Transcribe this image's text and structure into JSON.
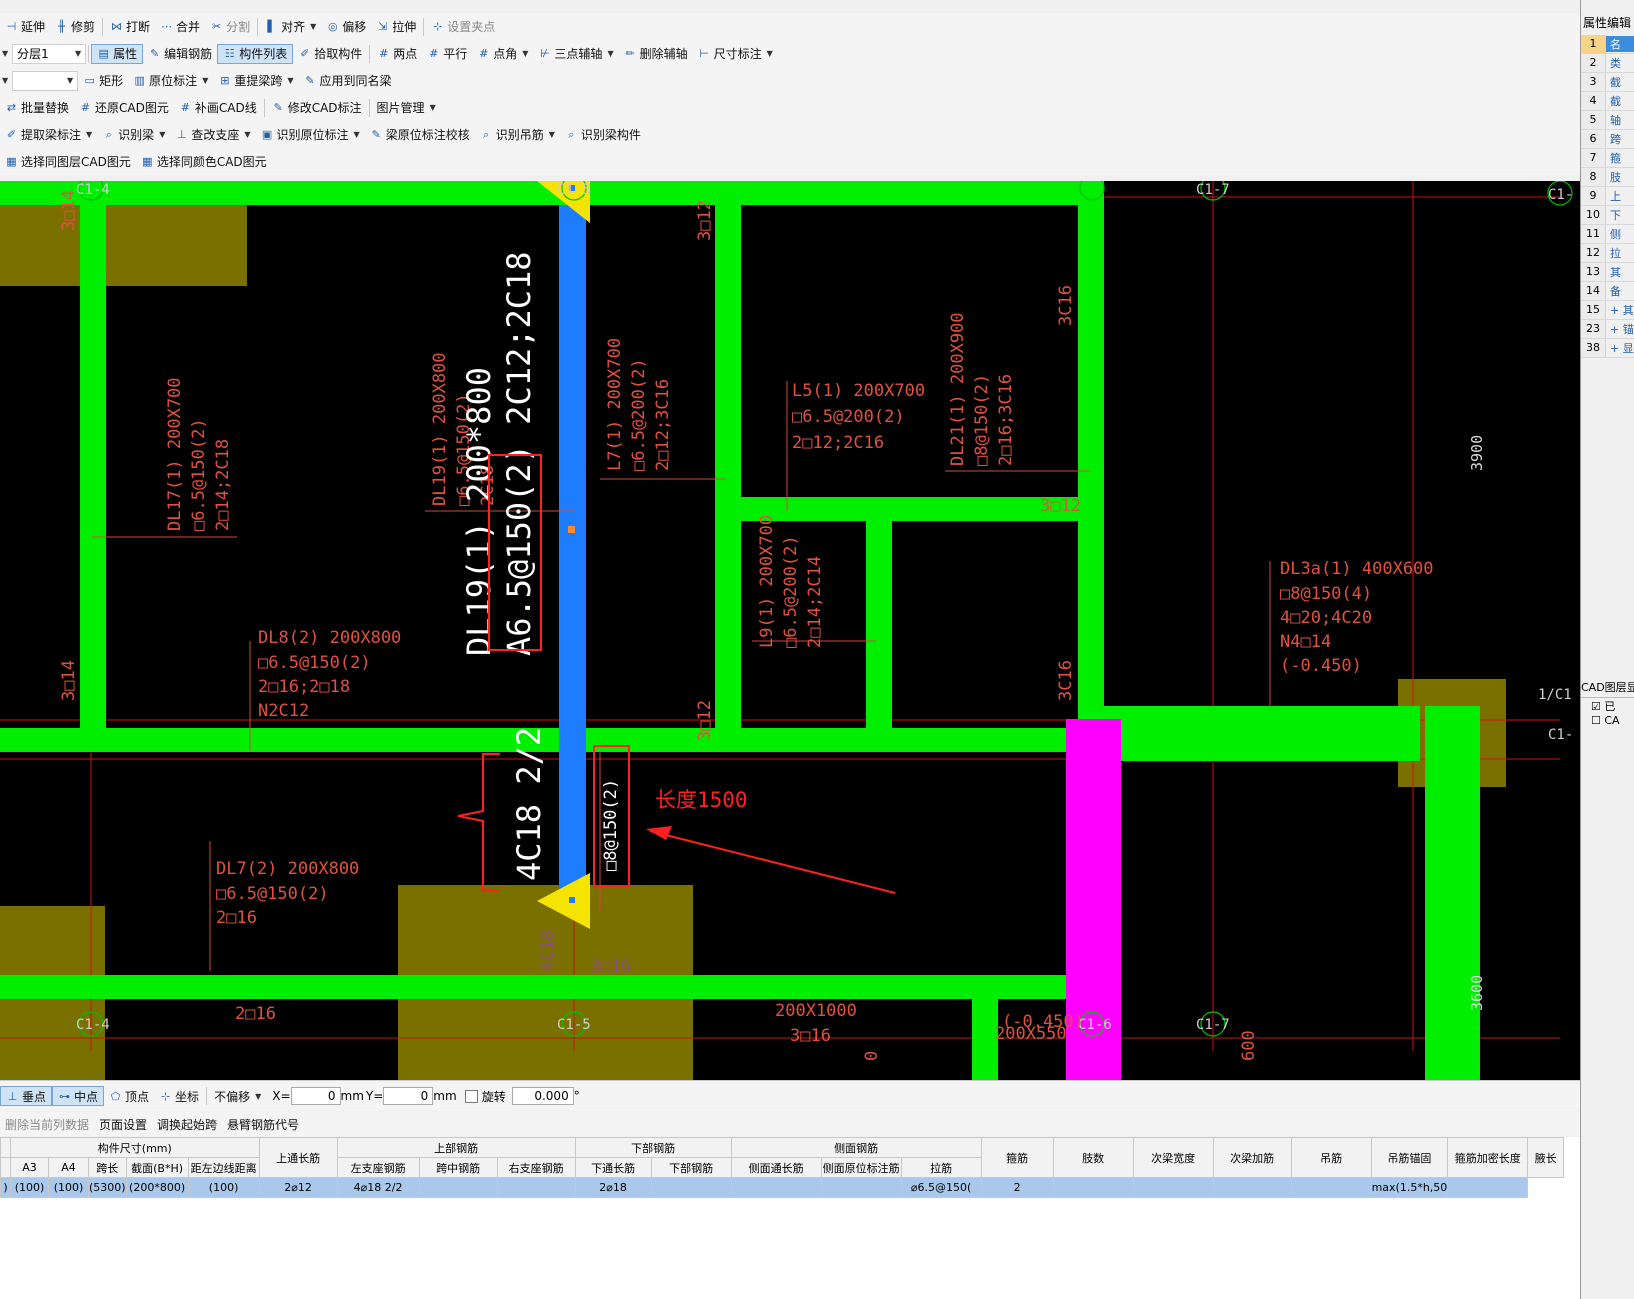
{
  "toolbar_row1": [
    "延伸",
    "修剪",
    "打断",
    "合并",
    "分割",
    "对齐",
    "偏移",
    "拉伸",
    "设置夹点"
  ],
  "toolbar_row2": {
    "floor_combo": "分层1",
    "items": [
      "属性",
      "编辑钢筋",
      "构件列表",
      "拾取构件",
      "两点",
      "平行",
      "点角",
      "三点辅轴",
      "删除辅轴",
      "尺寸标注"
    ]
  },
  "toolbar_row3": [
    "矩形",
    "原位标注",
    "重提梁跨",
    "应用到同名梁"
  ],
  "toolbar_row4": [
    "批量替换",
    "还原CAD图元",
    "补画CAD线",
    "修改CAD标注",
    "图片管理"
  ],
  "toolbar_row5": [
    "提取梁标注",
    "识别梁",
    "查改支座",
    "识别原位标注",
    "梁原位标注校核",
    "识别吊筋",
    "识别梁构件"
  ],
  "toolbar_row6": [
    "选择同图层CAD图元",
    "选择同颜色CAD图元"
  ],
  "cad": {
    "axes": [
      "C1-4",
      "C1-5",
      "C1-7",
      "C1-",
      "1/C1",
      "C1-",
      "C1-4",
      "C1-5",
      "C1-6",
      "C1-7"
    ],
    "big_label_line1": "DL19(1) 200*800",
    "big_label_line2": "A6.5@150(2) 2C12;2C18",
    "vertical_4c18": "4C18 2/2",
    "small_stirrup": "□8@150(2)",
    "length_note": "长度1500",
    "dl17": [
      "DL17(1) 200X700",
      "□6.5@150(2)",
      "2□14;2C18"
    ],
    "dl19_small": [
      "DL19(1) 200X800",
      "□6.5@150(2)",
      "2C18"
    ],
    "l7": [
      "L7(1) 200X700",
      "□6.5@200(2)",
      "2□12;3C16"
    ],
    "l5": [
      "L5(1) 200X700",
      "□6.5@200(2)",
      "2□12;2C16"
    ],
    "dl21": [
      "DL21(1) 200X900",
      "□8@150(2)",
      "2□16;3C16"
    ],
    "l9": [
      "L9(1) 200X700",
      "□6.5@200(2)",
      "2□14;2C14"
    ],
    "dl8": [
      "DL8(2) 200X800",
      "□6.5@150(2)",
      "2□16;2□18",
      "N2C12"
    ],
    "dl3a": [
      "DL3a(1) 400X600",
      "□8@150(4)",
      "4□20;4C20",
      "N4□14",
      "(-0.450)"
    ],
    "dl7": [
      "DL7(2) 200X800",
      "□6.5@150(2)",
      "2□16"
    ],
    "misc": [
      "3□12",
      "3C16",
      "3□12",
      "3□14",
      "3□12",
      "3C16",
      "3□14",
      "2□16",
      "200X1000",
      "3□16",
      "(-0.450)",
      "200X550",
      "3900",
      "3600",
      "4C18",
      "3□16",
      "600",
      "0"
    ]
  },
  "status_bar": {
    "items": [
      "垂点",
      "中点",
      "顶点",
      "坐标"
    ],
    "offset_mode": "不偏移",
    "x_label": "X=",
    "x_value": "0",
    "x_unit": "mm",
    "y_label": "Y=",
    "y_value": "0",
    "y_unit": "mm",
    "rotate_label": "旋转",
    "rotate_value": "0.000",
    "degree": "°"
  },
  "table_toolbar": [
    "删除当前列数据",
    "页面设置",
    "调换起始跨",
    "悬臂钢筋代号"
  ],
  "grid": {
    "group_headers": [
      "构件尺寸(mm)",
      "上通长筋",
      "上部钢筋",
      "下部钢筋",
      "侧面钢筋",
      "箍筋",
      "肢数",
      "次梁宽度",
      "次梁加筋",
      "吊筋",
      "吊筋锚固",
      "箍筋加密长度",
      "腋长"
    ],
    "sub_headers": [
      "A3",
      "A4",
      "跨长",
      "截面(B*H)",
      "距左边线距离",
      "左支座钢筋",
      "跨中钢筋",
      "右支座钢筋",
      "下通长筋",
      "下部钢筋",
      "侧面通长筋",
      "侧面原位标注筋",
      "拉筋"
    ],
    "row": [
      "(100)",
      "(100)",
      "(5300)",
      "(200*800)",
      "(100)",
      "2⌀12",
      "4⌀18 2/2",
      "",
      "",
      "2⌀18",
      "",
      "",
      "",
      "",
      "",
      "⌀6.5@150(",
      "2",
      "",
      "",
      "",
      "",
      "max(1.5*h,50",
      ""
    ]
  },
  "right_panel": {
    "title": "属性编辑",
    "rows": [
      {
        "n": "1",
        "v": "名"
      },
      {
        "n": "2",
        "v": "类"
      },
      {
        "n": "3",
        "v": "截"
      },
      {
        "n": "4",
        "v": "截"
      },
      {
        "n": "5",
        "v": "轴"
      },
      {
        "n": "6",
        "v": "跨"
      },
      {
        "n": "7",
        "v": "箍"
      },
      {
        "n": "8",
        "v": "肢"
      },
      {
        "n": "9",
        "v": "上"
      },
      {
        "n": "10",
        "v": "下"
      },
      {
        "n": "11",
        "v": "侧"
      },
      {
        "n": "12",
        "v": "拉"
      },
      {
        "n": "13",
        "v": "其"
      },
      {
        "n": "14",
        "v": "备"
      },
      {
        "n": "15",
        "v": "+ 其"
      },
      {
        "n": "23",
        "v": "+ 锚"
      },
      {
        "n": "38",
        "v": "+ 显"
      }
    ],
    "cad_layer_title": "CAD图层显",
    "cad_layer_items": [
      "已",
      "CA"
    ]
  }
}
